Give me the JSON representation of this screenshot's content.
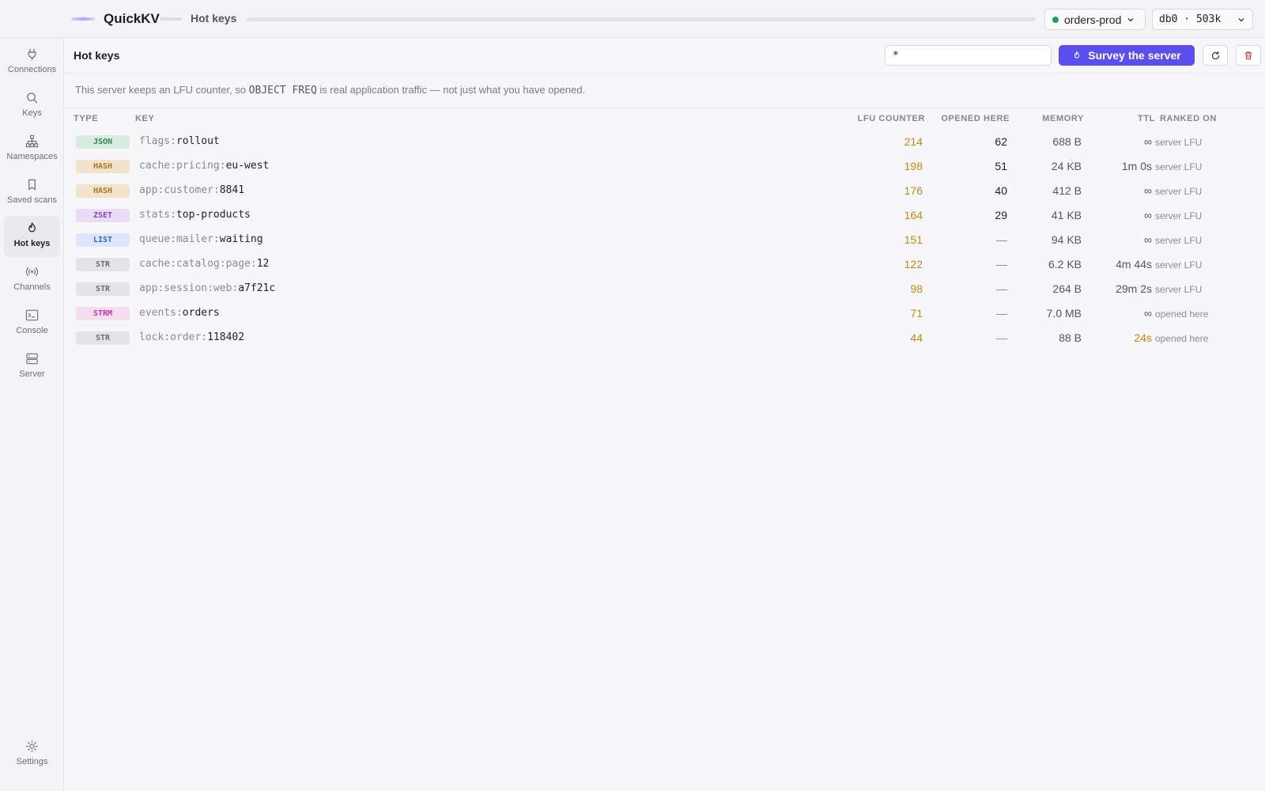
{
  "app": {
    "title": "QuickKV",
    "breadcrumb": "Hot keys"
  },
  "topbar": {
    "connection": {
      "name": "orders-prod",
      "status_color": "#1e9e5a"
    },
    "database": {
      "label": "db0 · 503k"
    }
  },
  "sidebar": {
    "items": [
      {
        "id": "connections",
        "label": "Connections",
        "icon": "plug-icon",
        "active": false
      },
      {
        "id": "keys",
        "label": "Keys",
        "icon": "search-icon",
        "active": false
      },
      {
        "id": "namespaces",
        "label": "Namespaces",
        "icon": "tree-icon",
        "active": false
      },
      {
        "id": "saved-scans",
        "label": "Saved scans",
        "icon": "bookmark-icon",
        "active": false
      },
      {
        "id": "hot-keys",
        "label": "Hot keys",
        "icon": "flame-icon",
        "active": true
      },
      {
        "id": "channels",
        "label": "Channels",
        "icon": "broadcast-icon",
        "active": false
      },
      {
        "id": "console",
        "label": "Console",
        "icon": "terminal-icon",
        "active": false
      },
      {
        "id": "server",
        "label": "Server",
        "icon": "server-icon",
        "active": false
      }
    ],
    "settings": {
      "label": "Settings",
      "icon": "gear-icon"
    }
  },
  "toolbar": {
    "title": "Hot keys",
    "pattern_value": "*",
    "survey_label": "Survey the server",
    "accent": "#5b4ef0"
  },
  "notice": {
    "prefix": "This server keeps an LFU counter, so",
    "command": "OBJECT FREQ",
    "suffix": "is real application traffic — not just what you have opened."
  },
  "table": {
    "columns": {
      "type": "TYPE",
      "key": "KEY",
      "lfu": "LFU COUNTER",
      "opened": "OPENED HERE",
      "memory": "MEMORY",
      "ttl": "TTL",
      "ranked": "RANKED ON"
    },
    "rows": [
      {
        "type": "JSON",
        "prefix": "flags:",
        "name": "rollout",
        "lfu": "214",
        "opened": "62",
        "memory": "688 B",
        "ttl": "∞",
        "ttl_warn": false,
        "ranked": "server LFU"
      },
      {
        "type": "HASH",
        "prefix": "cache:pricing:",
        "name": "eu-west",
        "lfu": "198",
        "opened": "51",
        "memory": "24 KB",
        "ttl": "1m 0s",
        "ttl_warn": false,
        "ranked": "server LFU"
      },
      {
        "type": "HASH",
        "prefix": "app:customer:",
        "name": "8841",
        "lfu": "176",
        "opened": "40",
        "memory": "412 B",
        "ttl": "∞",
        "ttl_warn": false,
        "ranked": "server LFU"
      },
      {
        "type": "ZSET",
        "prefix": "stats:",
        "name": "top-products",
        "lfu": "164",
        "opened": "29",
        "memory": "41 KB",
        "ttl": "∞",
        "ttl_warn": false,
        "ranked": "server LFU"
      },
      {
        "type": "LIST",
        "prefix": "queue:mailer:",
        "name": "waiting",
        "lfu": "151",
        "opened": "—",
        "memory": "94 KB",
        "ttl": "∞",
        "ttl_warn": false,
        "ranked": "server LFU"
      },
      {
        "type": "STR",
        "prefix": "cache:catalog:page:",
        "name": "12",
        "lfu": "122",
        "opened": "—",
        "memory": "6.2 KB",
        "ttl": "4m 44s",
        "ttl_warn": false,
        "ranked": "server LFU"
      },
      {
        "type": "STR",
        "prefix": "app:session:web:",
        "name": "a7f21c",
        "lfu": "98",
        "opened": "—",
        "memory": "264 B",
        "ttl": "29m 2s",
        "ttl_warn": false,
        "ranked": "server LFU"
      },
      {
        "type": "STRM",
        "prefix": "events:",
        "name": "orders",
        "lfu": "71",
        "opened": "—",
        "memory": "7.0 MB",
        "ttl": "∞",
        "ttl_warn": false,
        "ranked": "opened here"
      },
      {
        "type": "STR",
        "prefix": "lock:order:",
        "name": "118402",
        "lfu": "44",
        "opened": "—",
        "memory": "88 B",
        "ttl": "24s",
        "ttl_warn": true,
        "ranked": "opened here"
      }
    ]
  },
  "type_colors": {
    "JSON": {
      "bg": "#d8ece0",
      "fg": "#2a8a4f"
    },
    "HASH": {
      "bg": "#f1e3cc",
      "fg": "#b07617"
    },
    "ZSET": {
      "bg": "#eadcf6",
      "fg": "#8a45c9"
    },
    "LIST": {
      "bg": "#dbe7fa",
      "fg": "#3566c8"
    },
    "STR": {
      "bg": "#e4e4e8",
      "fg": "#6b6c74"
    },
    "STRM": {
      "bg": "#f5dcef",
      "fg": "#c23a9d"
    }
  }
}
